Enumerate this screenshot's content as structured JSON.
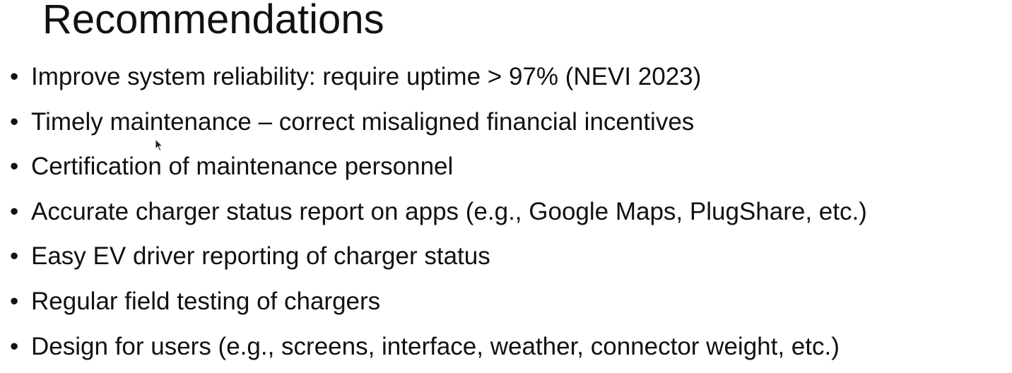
{
  "slide": {
    "title": "Recommendations",
    "bullet_glyph": "•",
    "bullets": [
      "Improve system reliability:  require uptime > 97% (NEVI 2023)",
      "Timely maintenance – correct misaligned financial incentives",
      "Certification of maintenance personnel",
      "Accurate charger status report on apps (e.g., Google Maps, PlugShare, etc.)",
      "Easy EV driver reporting of charger status",
      "Regular field testing of chargers",
      "Design for users (e.g., screens, interface, weather, connector weight, etc.)"
    ]
  },
  "icons": {
    "cursor": "mouse-pointer-icon"
  },
  "colors": {
    "text": "#111111",
    "background": "#ffffff"
  }
}
